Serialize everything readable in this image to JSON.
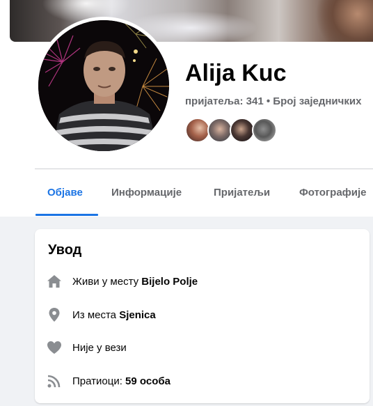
{
  "profile": {
    "name": "Alija Kuc",
    "friends_line": "пријатеља: 341 • Број заједничких"
  },
  "mutual_friends": [
    {
      "name": "mutual-friend-1"
    },
    {
      "name": "mutual-friend-2"
    },
    {
      "name": "mutual-friend-3"
    },
    {
      "name": "mutual-friend-4"
    }
  ],
  "tabs": [
    {
      "label": "Објаве",
      "active": true
    },
    {
      "label": "Информације",
      "active": false
    },
    {
      "label": "Пријатељи",
      "active": false
    },
    {
      "label": "Фотографије",
      "active": false
    }
  ],
  "intro": {
    "title": "Увод",
    "items": [
      {
        "icon": "home-icon",
        "prefix": "Живи у месту ",
        "value": "Bijelo Polje"
      },
      {
        "icon": "location-pin-icon",
        "prefix": "Из места ",
        "value": "Sjenica"
      },
      {
        "icon": "heart-icon",
        "prefix": "Није у вези",
        "value": ""
      },
      {
        "icon": "rss-feed-icon",
        "prefix": "Пратиоци: ",
        "value": "59 особа"
      }
    ]
  },
  "colors": {
    "accent": "#1b74e4",
    "secondary_text": "#65676b",
    "page_background": "#f0f2f5",
    "icon_gray": "#8a8d91"
  }
}
